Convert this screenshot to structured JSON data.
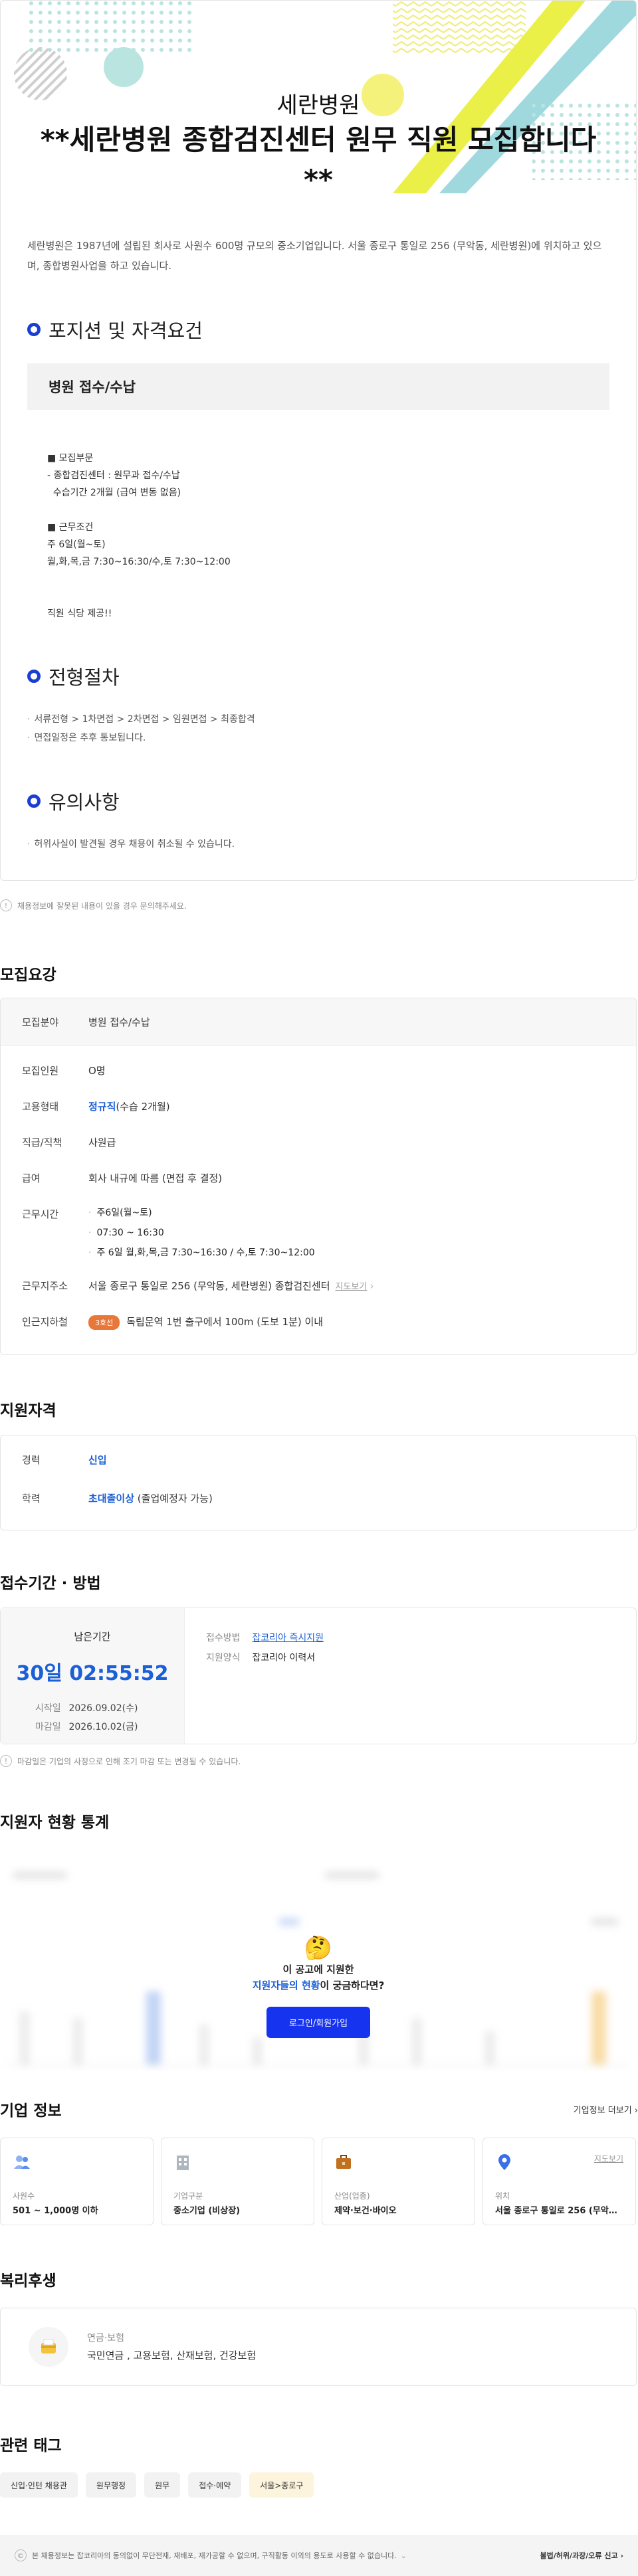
{
  "post": {
    "company": "세란병원",
    "title": "**세란병원 종합검진센터 원무 직원 모집합니다**",
    "intro": "세란병원은 1987년에 설립된 회사로 사원수 600명 규모의 중소기업입니다. 서울 종로구 통일로 256 (무악동, 세란병원)에 위치하고 있으며, 종합병원사업을 하고 있습니다.",
    "sec_position": "포지션 및 자격요건",
    "position_name": "병원 접수/수납",
    "req_lines_1": [
      "■ 모집부문",
      "- 종합검진센터 : 원무과 접수/수납",
      "  수습기간 2개월 (급여 변동 없음)"
    ],
    "req_lines_2": [
      "■ 근무조건",
      "주 6일(월~토)",
      "월,화,목,금 7:30~16:30/수,토 7:30~12:00"
    ],
    "req_lines_3": [
      "직원 식당 제공!!"
    ],
    "sec_process": "전형절차",
    "process_lines": [
      "서류전형 > 1차면접 > 2차면접 > 임원면접 > 최종합격",
      "면접일정은 추후 통보됩니다."
    ],
    "sec_notice": "유의사항",
    "notice_lines": [
      "허위사실이 발견될 경우 채용이 취소될 수 있습니다."
    ]
  },
  "report_note": "채용정보에 잘못된 내용이 있을 경우 문의해주세요.",
  "summary": {
    "heading": "모집요강",
    "field_label": "모집분야",
    "field_value": "병원 접수/수납",
    "rows": [
      {
        "label": "모집인원",
        "value": "O명"
      },
      {
        "label": "고용형태",
        "value_blue": "정규직",
        "value": "(수습 2개월)"
      },
      {
        "label": "직급/직책",
        "value": "사원급"
      },
      {
        "label": "급여",
        "value": "회사 내규에 따름 (면접 후 결정)"
      }
    ],
    "hours_label": "근무시간",
    "hours": [
      "주6일(월~토)",
      "07:30 ~ 16:30",
      "주 6일 월,화,목,금 7:30~16:30 / 수,토 7:30~12:00"
    ],
    "address_label": "근무지주소",
    "address": "서울 종로구 통일로 256 (무악동, 세란병원) 종합검진센터",
    "map_label": "지도보기",
    "subway_label": "인근지하철",
    "subway_line": "3호선",
    "subway_text": "독립문역 1번 출구에서 100m (도보 1분) 이내"
  },
  "qualification": {
    "heading": "지원자격",
    "career_label": "경력",
    "career_value": "신입",
    "edu_label": "학력",
    "edu_blue": "초대졸이상",
    "edu_value": "(졸업예정자 가능)"
  },
  "apply": {
    "heading": "접수기간 · 방법",
    "remain_label": "남은기간",
    "countdown": "30일 02:55:52",
    "start_label": "시작일",
    "start": "2026.09.02(수)",
    "end_label": "마감일",
    "end": "2026.10.02(금)",
    "method_label": "접수방법",
    "method_value": "잡코리아 즉시지원",
    "form_label": "지원양식",
    "form_value": "잡코리아 이력서",
    "note": "마감일은 기업의 사정으로 인해 조기 마감 또는 변경될 수 있습니다."
  },
  "stats": {
    "heading": "지원자 현황 통계",
    "q_line1": "이 공고에 지원한",
    "q_blue": "지원자들의 현황",
    "q_line2_tail": "이 궁금하다면?",
    "login_button": "로그인/회원가입"
  },
  "company": {
    "heading": "기업 정보",
    "more_link": "기업정보 더보기",
    "cards": [
      {
        "key": "사원수",
        "value": "501 ~ 1,000명 이하",
        "icon": "people-icon",
        "color": "#5b8def"
      },
      {
        "key": "기업구분",
        "value": "중소기업 (비상장)",
        "icon": "building-icon",
        "color": "#9aa3ad"
      },
      {
        "key": "산업(업종)",
        "value": "제약·보건·바이오",
        "icon": "briefcase-icon",
        "color": "#c0701f"
      },
      {
        "key": "위치",
        "value": "서울 종로구 통일로 256 (무악동...",
        "icon": "location-pin-icon",
        "color": "#3a6fe8",
        "map": "지도보기"
      }
    ]
  },
  "welfare": {
    "heading": "복리후생",
    "category": "연금·보험",
    "items": "국민연금 , 고용보험, 산재보험, 건강보험"
  },
  "tags": {
    "heading": "관련 태그",
    "items": [
      "신입·인턴 채용관",
      "원무행정",
      "원무",
      "접수·예약",
      "서울>종로구"
    ]
  },
  "footer": {
    "notice": "본 채용정보는 잡코리아의 동의없이 무단전재, 재배포, 재가공할 수 없으며, 구직활동 이외의 용도로 사용할 수 없습니다.",
    "report": "불법/허위/과장/오류 신고"
  }
}
